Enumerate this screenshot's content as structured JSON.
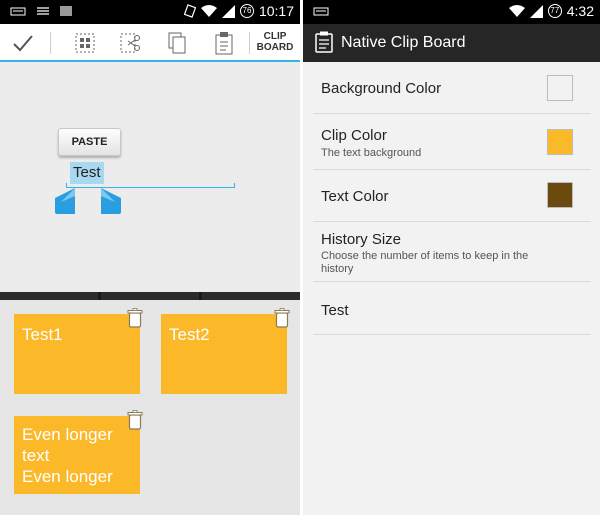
{
  "left_phone": {
    "status_time": "10:17",
    "status_badge": "76",
    "actionbar": {
      "clip_board_label_line1": "CLIP",
      "clip_board_label_line2": "BOARD"
    },
    "editor": {
      "paste_label": "PASTE",
      "selected_text": "Test"
    },
    "clips": [
      {
        "text": "Test1"
      },
      {
        "text": "Test2"
      },
      {
        "text_line1": "Even longer",
        "text_line2": "text",
        "text_line3": "Even longer"
      }
    ]
  },
  "right_phone": {
    "status_time": "4:32",
    "status_badge": "77",
    "app_title": "Native Clip Board",
    "prefs": [
      {
        "title": "Background Color",
        "color": "#f2f2f2"
      },
      {
        "title": "Clip Color",
        "summary": "The text background",
        "color": "#fbb829"
      },
      {
        "title": "Text Color",
        "color": "#6b4a0f"
      },
      {
        "title": "History Size",
        "summary": "Choose the number of items to keep in the history"
      },
      {
        "title": "Test"
      }
    ]
  },
  "colors": {
    "accent_blue": "#33b5e5",
    "clip_yellow": "#fbb829",
    "handle_blue": "#2a9ee0"
  }
}
